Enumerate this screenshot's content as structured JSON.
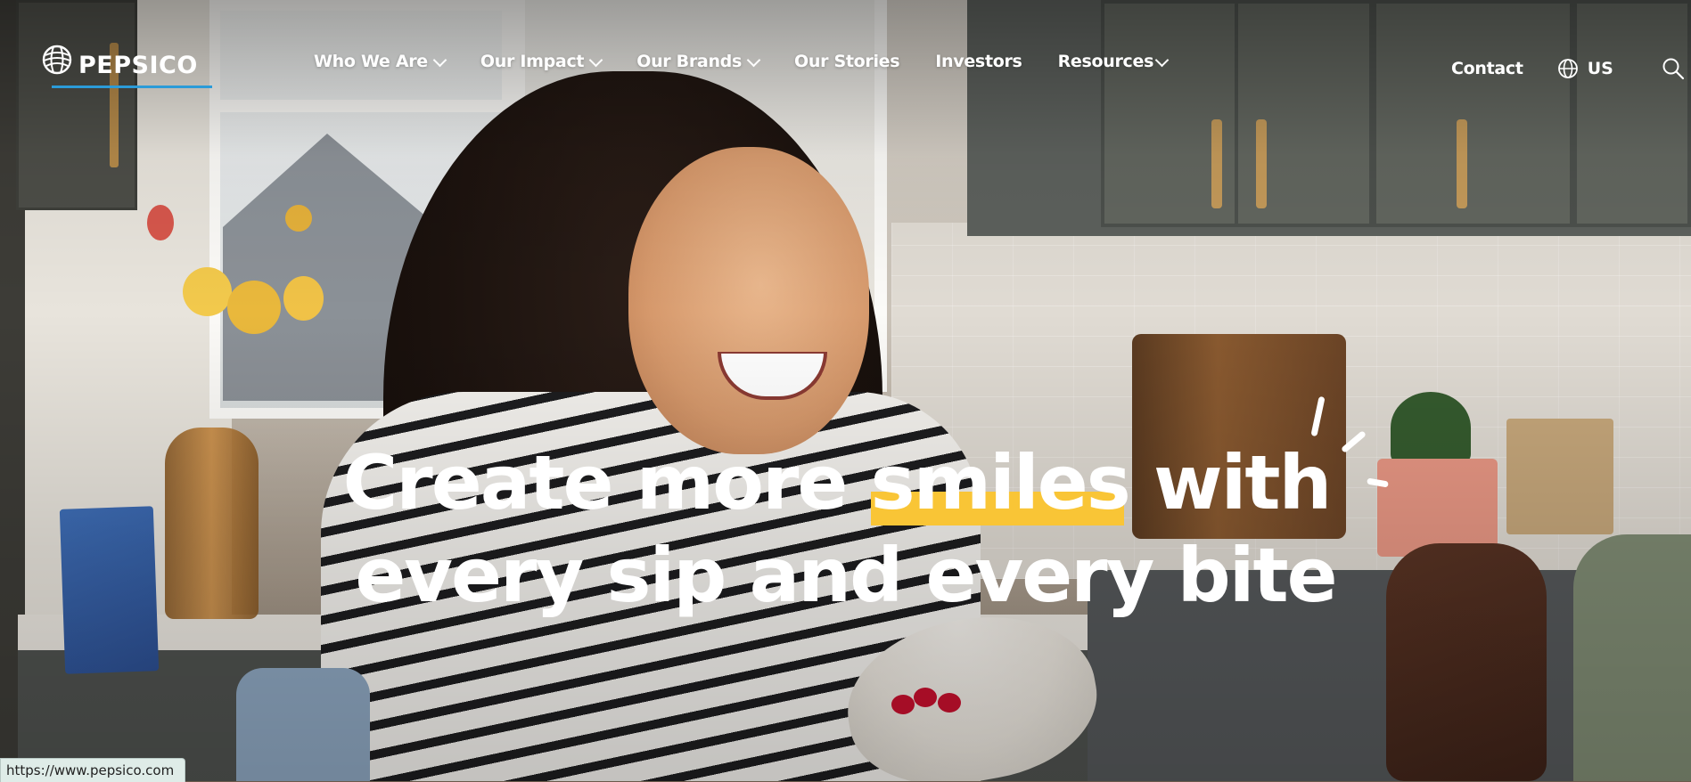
{
  "brand": {
    "name": "PEPSICO",
    "underline_color": "#2b9bd8",
    "logo_icon": "pepsico-globe-icon"
  },
  "nav": {
    "items": [
      {
        "label": "Who We Are",
        "has_dropdown": true
      },
      {
        "label": "Our Impact",
        "has_dropdown": true
      },
      {
        "label": "Our Brands",
        "has_dropdown": true
      },
      {
        "label": "Our Stories",
        "has_dropdown": false
      },
      {
        "label": "Investors",
        "has_dropdown": false
      },
      {
        "label": "Resources",
        "has_dropdown": true
      }
    ],
    "contact_label": "Contact",
    "locale_label": "US",
    "locale_icon": "globe-icon",
    "search_icon": "search-icon"
  },
  "hero": {
    "headline_pre": "Create more ",
    "headline_highlight": "smiles",
    "headline_post": " with",
    "headline_line2": "every sip and every bite",
    "highlight_color": "#f9c536"
  },
  "status_bar": {
    "url": "https://www.pepsico.com"
  }
}
